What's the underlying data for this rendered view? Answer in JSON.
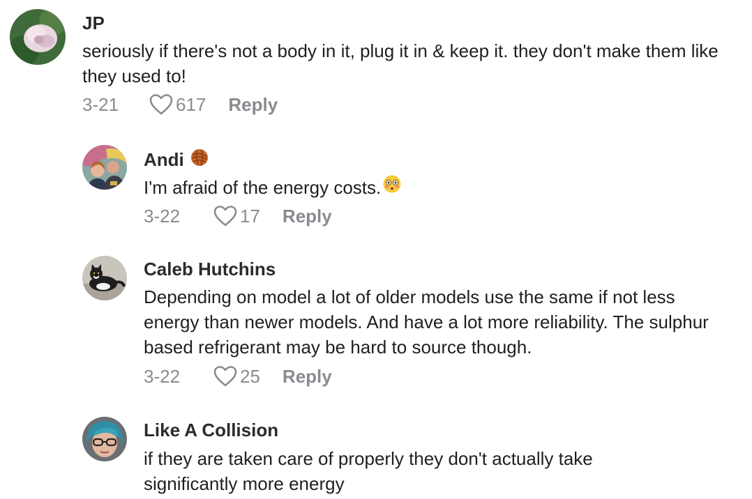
{
  "comments": [
    {
      "user": "JP",
      "text": "seriously if there's not a body in it, plug it in & keep it. they don't make them like they used to!",
      "date": "3-21",
      "likes": "617",
      "reply": "Reply",
      "avatar_icon": "peony-flower-avatar"
    },
    {
      "user": "Andi",
      "badge_icon": "yarn-ball-emoji",
      "text": "I'm afraid of the energy costs.",
      "text_emoji": "flushed-face-emoji",
      "date": "3-22",
      "likes": "17",
      "reply": "Reply",
      "avatar_icon": "couple-photo-avatar"
    },
    {
      "user": "Caleb Hutchins",
      "text": "Depending on model a lot of older models use the same if not less energy than newer models. And have a lot more reliability. The sulphur based refrigerant may be hard to source though.",
      "date": "3-22",
      "likes": "25",
      "reply": "Reply",
      "avatar_icon": "cat-photo-avatar"
    },
    {
      "user": "Like A Collision",
      "text": "if they are taken care of properly they don't actually take significantly more energy",
      "avatar_icon": "person-glasses-avatar"
    }
  ],
  "colors": {
    "name": "#2b2b2b",
    "text": "#1f1f1f",
    "meta": "#8a8b91",
    "background": "#ffffff"
  }
}
